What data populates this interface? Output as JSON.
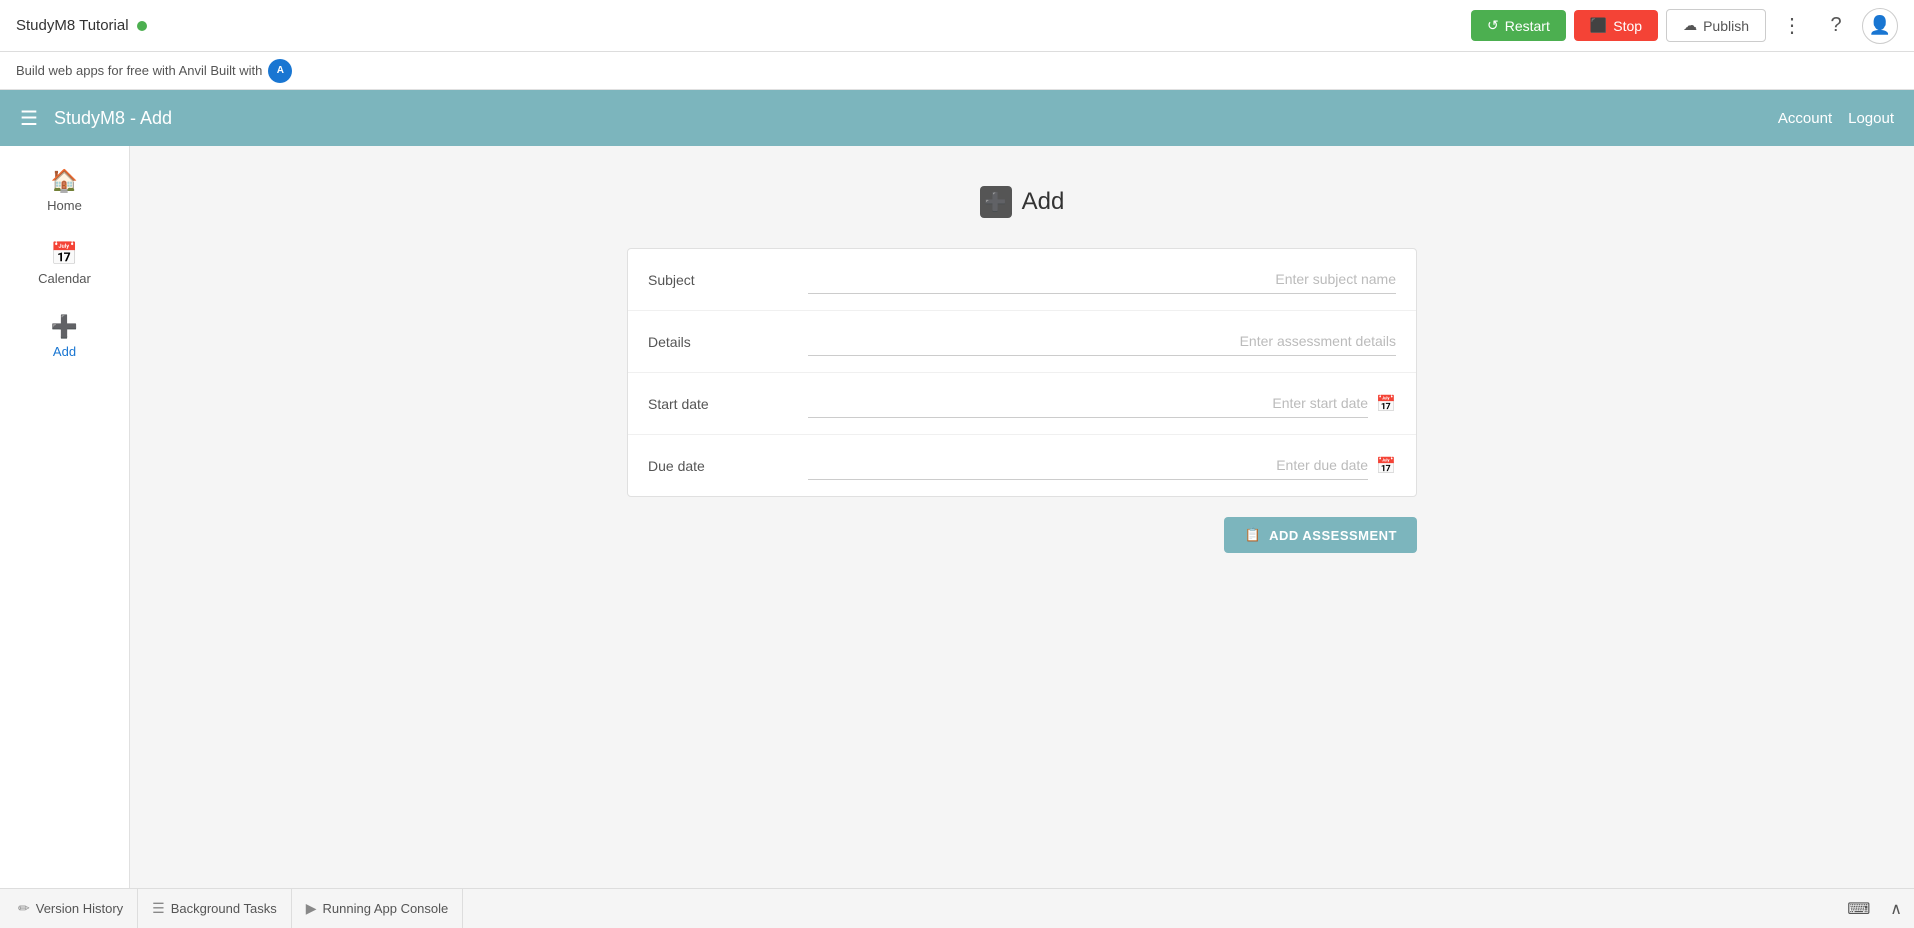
{
  "topbar": {
    "app_title": "StudyM8 Tutorial",
    "restart_label": "Restart",
    "stop_label": "Stop",
    "publish_label": "Publish"
  },
  "anvil_banner": {
    "text": "Build web apps for free with Anvil Built with"
  },
  "app_nav": {
    "title": "StudyM8 - Add",
    "account_label": "Account",
    "logout_label": "Logout"
  },
  "sidebar": {
    "items": [
      {
        "label": "Home",
        "icon": "🏠"
      },
      {
        "label": "Calendar",
        "icon": "📅"
      },
      {
        "label": "Add",
        "icon": "➕"
      }
    ]
  },
  "page": {
    "title": "Add",
    "form": {
      "subject_label": "Subject",
      "subject_placeholder": "Enter subject name",
      "details_label": "Details",
      "details_placeholder": "Enter assessment details",
      "start_date_label": "Start date",
      "start_date_placeholder": "Enter start date",
      "due_date_label": "Due date",
      "due_date_placeholder": "Enter due date"
    },
    "add_button_label": "ADD ASSESSMENT"
  },
  "bottombar": {
    "version_history_label": "Version History",
    "background_tasks_label": "Background Tasks",
    "running_app_console_label": "Running App Console"
  }
}
